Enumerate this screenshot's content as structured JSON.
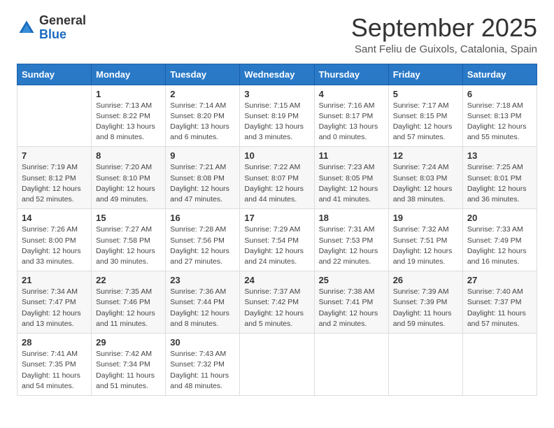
{
  "header": {
    "logo_line1": "General",
    "logo_line2": "Blue",
    "month": "September 2025",
    "location": "Sant Feliu de Guixols, Catalonia, Spain"
  },
  "weekdays": [
    "Sunday",
    "Monday",
    "Tuesday",
    "Wednesday",
    "Thursday",
    "Friday",
    "Saturday"
  ],
  "weeks": [
    [
      {
        "day": "",
        "sunrise": "",
        "sunset": "",
        "daylight": ""
      },
      {
        "day": "1",
        "sunrise": "Sunrise: 7:13 AM",
        "sunset": "Sunset: 8:22 PM",
        "daylight": "Daylight: 13 hours and 8 minutes."
      },
      {
        "day": "2",
        "sunrise": "Sunrise: 7:14 AM",
        "sunset": "Sunset: 8:20 PM",
        "daylight": "Daylight: 13 hours and 6 minutes."
      },
      {
        "day": "3",
        "sunrise": "Sunrise: 7:15 AM",
        "sunset": "Sunset: 8:19 PM",
        "daylight": "Daylight: 13 hours and 3 minutes."
      },
      {
        "day": "4",
        "sunrise": "Sunrise: 7:16 AM",
        "sunset": "Sunset: 8:17 PM",
        "daylight": "Daylight: 13 hours and 0 minutes."
      },
      {
        "day": "5",
        "sunrise": "Sunrise: 7:17 AM",
        "sunset": "Sunset: 8:15 PM",
        "daylight": "Daylight: 12 hours and 57 minutes."
      },
      {
        "day": "6",
        "sunrise": "Sunrise: 7:18 AM",
        "sunset": "Sunset: 8:13 PM",
        "daylight": "Daylight: 12 hours and 55 minutes."
      }
    ],
    [
      {
        "day": "7",
        "sunrise": "Sunrise: 7:19 AM",
        "sunset": "Sunset: 8:12 PM",
        "daylight": "Daylight: 12 hours and 52 minutes."
      },
      {
        "day": "8",
        "sunrise": "Sunrise: 7:20 AM",
        "sunset": "Sunset: 8:10 PM",
        "daylight": "Daylight: 12 hours and 49 minutes."
      },
      {
        "day": "9",
        "sunrise": "Sunrise: 7:21 AM",
        "sunset": "Sunset: 8:08 PM",
        "daylight": "Daylight: 12 hours and 47 minutes."
      },
      {
        "day": "10",
        "sunrise": "Sunrise: 7:22 AM",
        "sunset": "Sunset: 8:07 PM",
        "daylight": "Daylight: 12 hours and 44 minutes."
      },
      {
        "day": "11",
        "sunrise": "Sunrise: 7:23 AM",
        "sunset": "Sunset: 8:05 PM",
        "daylight": "Daylight: 12 hours and 41 minutes."
      },
      {
        "day": "12",
        "sunrise": "Sunrise: 7:24 AM",
        "sunset": "Sunset: 8:03 PM",
        "daylight": "Daylight: 12 hours and 38 minutes."
      },
      {
        "day": "13",
        "sunrise": "Sunrise: 7:25 AM",
        "sunset": "Sunset: 8:01 PM",
        "daylight": "Daylight: 12 hours and 36 minutes."
      }
    ],
    [
      {
        "day": "14",
        "sunrise": "Sunrise: 7:26 AM",
        "sunset": "Sunset: 8:00 PM",
        "daylight": "Daylight: 12 hours and 33 minutes."
      },
      {
        "day": "15",
        "sunrise": "Sunrise: 7:27 AM",
        "sunset": "Sunset: 7:58 PM",
        "daylight": "Daylight: 12 hours and 30 minutes."
      },
      {
        "day": "16",
        "sunrise": "Sunrise: 7:28 AM",
        "sunset": "Sunset: 7:56 PM",
        "daylight": "Daylight: 12 hours and 27 minutes."
      },
      {
        "day": "17",
        "sunrise": "Sunrise: 7:29 AM",
        "sunset": "Sunset: 7:54 PM",
        "daylight": "Daylight: 12 hours and 24 minutes."
      },
      {
        "day": "18",
        "sunrise": "Sunrise: 7:31 AM",
        "sunset": "Sunset: 7:53 PM",
        "daylight": "Daylight: 12 hours and 22 minutes."
      },
      {
        "day": "19",
        "sunrise": "Sunrise: 7:32 AM",
        "sunset": "Sunset: 7:51 PM",
        "daylight": "Daylight: 12 hours and 19 minutes."
      },
      {
        "day": "20",
        "sunrise": "Sunrise: 7:33 AM",
        "sunset": "Sunset: 7:49 PM",
        "daylight": "Daylight: 12 hours and 16 minutes."
      }
    ],
    [
      {
        "day": "21",
        "sunrise": "Sunrise: 7:34 AM",
        "sunset": "Sunset: 7:47 PM",
        "daylight": "Daylight: 12 hours and 13 minutes."
      },
      {
        "day": "22",
        "sunrise": "Sunrise: 7:35 AM",
        "sunset": "Sunset: 7:46 PM",
        "daylight": "Daylight: 12 hours and 11 minutes."
      },
      {
        "day": "23",
        "sunrise": "Sunrise: 7:36 AM",
        "sunset": "Sunset: 7:44 PM",
        "daylight": "Daylight: 12 hours and 8 minutes."
      },
      {
        "day": "24",
        "sunrise": "Sunrise: 7:37 AM",
        "sunset": "Sunset: 7:42 PM",
        "daylight": "Daylight: 12 hours and 5 minutes."
      },
      {
        "day": "25",
        "sunrise": "Sunrise: 7:38 AM",
        "sunset": "Sunset: 7:41 PM",
        "daylight": "Daylight: 12 hours and 2 minutes."
      },
      {
        "day": "26",
        "sunrise": "Sunrise: 7:39 AM",
        "sunset": "Sunset: 7:39 PM",
        "daylight": "Daylight: 11 hours and 59 minutes."
      },
      {
        "day": "27",
        "sunrise": "Sunrise: 7:40 AM",
        "sunset": "Sunset: 7:37 PM",
        "daylight": "Daylight: 11 hours and 57 minutes."
      }
    ],
    [
      {
        "day": "28",
        "sunrise": "Sunrise: 7:41 AM",
        "sunset": "Sunset: 7:35 PM",
        "daylight": "Daylight: 11 hours and 54 minutes."
      },
      {
        "day": "29",
        "sunrise": "Sunrise: 7:42 AM",
        "sunset": "Sunset: 7:34 PM",
        "daylight": "Daylight: 11 hours and 51 minutes."
      },
      {
        "day": "30",
        "sunrise": "Sunrise: 7:43 AM",
        "sunset": "Sunset: 7:32 PM",
        "daylight": "Daylight: 11 hours and 48 minutes."
      },
      {
        "day": "",
        "sunrise": "",
        "sunset": "",
        "daylight": ""
      },
      {
        "day": "",
        "sunrise": "",
        "sunset": "",
        "daylight": ""
      },
      {
        "day": "",
        "sunrise": "",
        "sunset": "",
        "daylight": ""
      },
      {
        "day": "",
        "sunrise": "",
        "sunset": "",
        "daylight": ""
      }
    ]
  ]
}
